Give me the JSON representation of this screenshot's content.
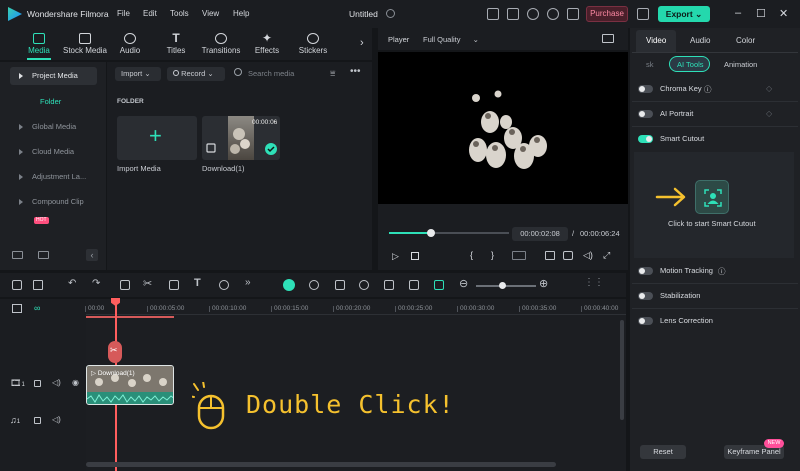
{
  "app": {
    "title": "Wondershare Filmora",
    "project": "Untitled",
    "menu": [
      "File",
      "Edit",
      "Tools",
      "View",
      "Help"
    ],
    "purchase_label": "Purchase",
    "export_label": "Export",
    "colors": {
      "accent": "#2ee0b8",
      "purchase": "#ff8aa4",
      "annotation": "#f5c12e",
      "playhead": "#ff5e5e"
    }
  },
  "media_tabs": [
    "Media",
    "Stock Media",
    "Audio",
    "Titles",
    "Transitions",
    "Effects",
    "Stickers"
  ],
  "sidebar": {
    "items": [
      "Project Media",
      "Global Media",
      "Cloud Media",
      "Adjustment La...",
      "Compound Clip"
    ],
    "folder": "Folder",
    "hot_badge": "HOT"
  },
  "media": {
    "import_label": "Import",
    "record_label": "Record",
    "search_placeholder": "Search media",
    "folder_header": "FOLDER",
    "import_tile_label": "Import Media",
    "clip_label": "Download(1)",
    "clip_duration": "00:00:06"
  },
  "player": {
    "label": "Player",
    "quality": "Full Quality",
    "current_time": "00:00:02:08",
    "separator": "/",
    "total_time": "00:00:06:24",
    "progress": 0.35
  },
  "right_panel": {
    "tabs": [
      "Video",
      "Audio",
      "Color"
    ],
    "subtabs": [
      "sk",
      "AI Tools",
      "Animation"
    ],
    "features_top": [
      {
        "label": "Chroma Key",
        "on": false
      },
      {
        "label": "AI Portrait",
        "on": false
      },
      {
        "label": "Smart Cutout",
        "on": true
      }
    ],
    "cutout_prompt": "Click to start Smart Cutout",
    "features_bottom": [
      {
        "label": "Motion Tracking",
        "on": false
      },
      {
        "label": "Stabilization",
        "on": false
      },
      {
        "label": "Lens Correction",
        "on": false
      }
    ],
    "reset_label": "Reset",
    "keyframe_label": "Keyframe Panel",
    "new_badge": "NEW"
  },
  "timeline": {
    "ticks": [
      "00:00",
      "00:00:05:00",
      "00:00:10:00",
      "00:00:15:00",
      "00:00:20:00",
      "00:00:25:00",
      "00:00:30:00",
      "00:00:35:00",
      "00:00:40:00"
    ],
    "clip_label": "Download(1)",
    "video_track_num": "1",
    "audio_track_num": "1"
  },
  "annotation": {
    "text": "Double Click!"
  }
}
